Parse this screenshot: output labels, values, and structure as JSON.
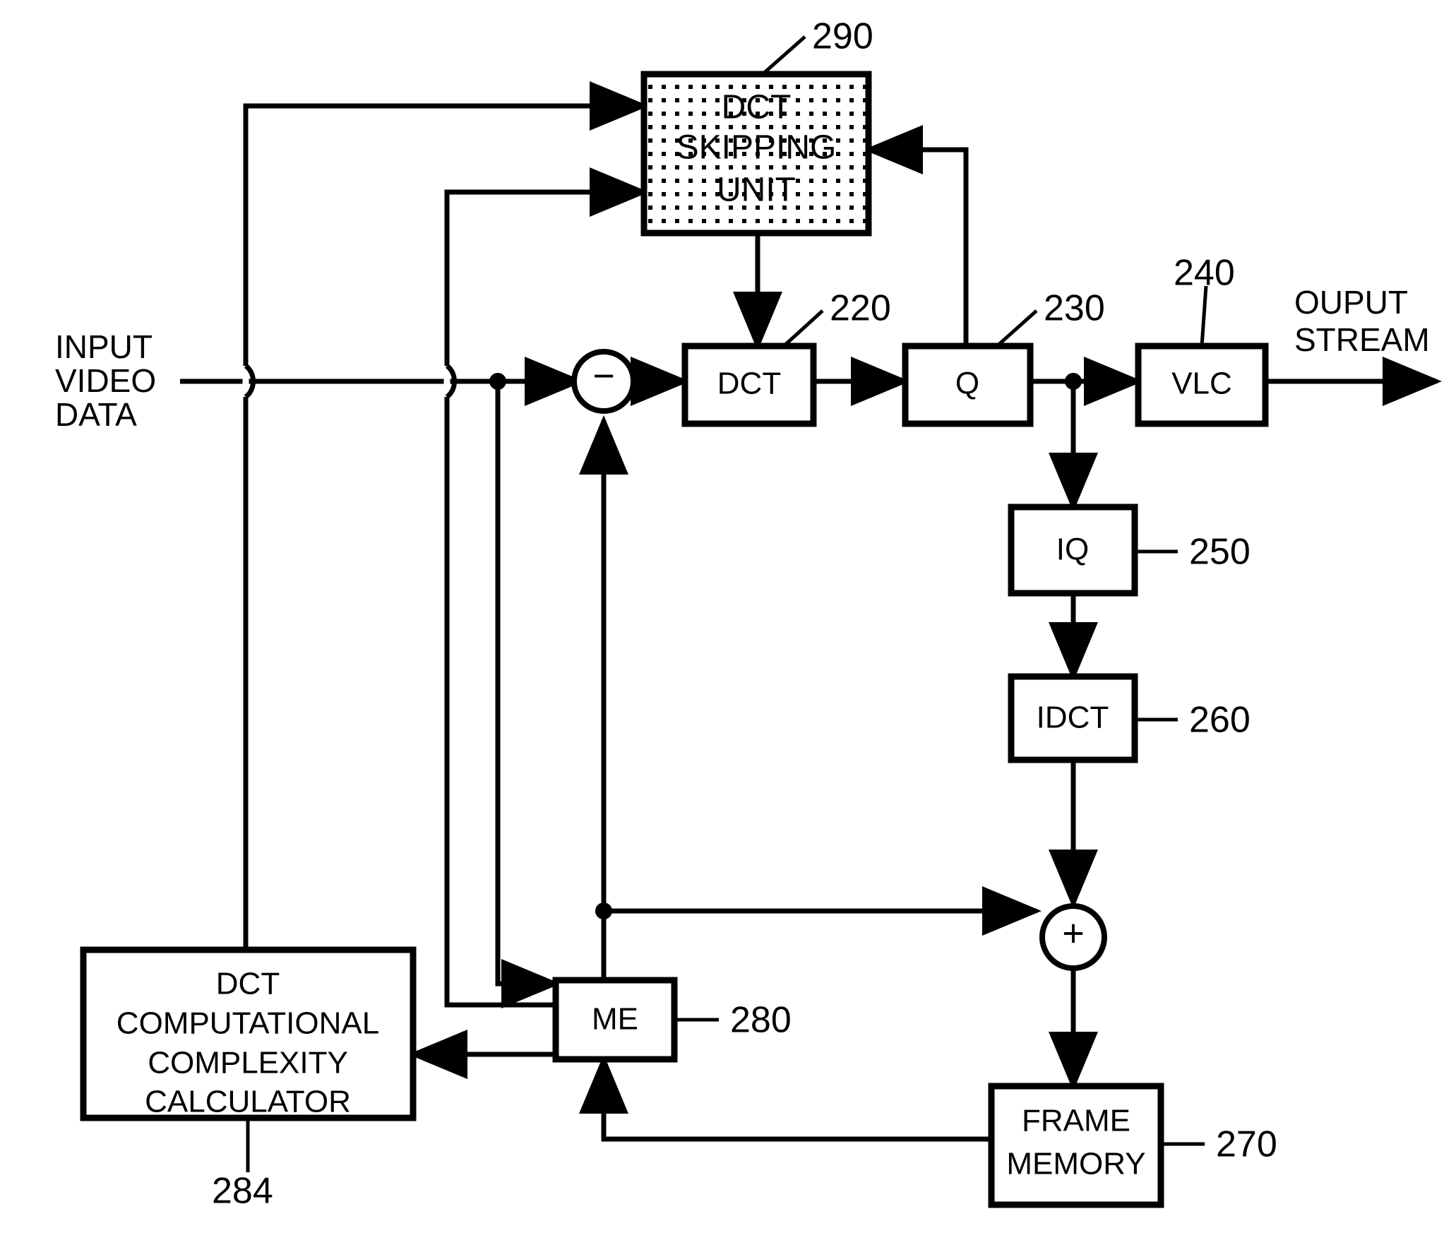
{
  "figure": {
    "type": "patent-block-diagram",
    "title": "Video encoder with DCT skipping unit"
  },
  "blocks": {
    "dct_skipping_unit": {
      "label_lines": [
        "DCT",
        "SKIPPING",
        "UNIT"
      ],
      "ref": "290",
      "fill": "stipple"
    },
    "dct": {
      "label": "DCT",
      "ref": "220"
    },
    "q": {
      "label": "Q",
      "ref": "230"
    },
    "vlc": {
      "label": "VLC",
      "ref": "240"
    },
    "iq": {
      "label": "IQ",
      "ref": "250"
    },
    "idct": {
      "label": "IDCT",
      "ref": "260"
    },
    "frame_memory": {
      "label_lines": [
        "FRAME",
        "MEMORY"
      ],
      "ref": "270"
    },
    "me": {
      "label": "ME",
      "ref": "280"
    },
    "calculator": {
      "label_lines": [
        "DCT",
        "COMPUTATIONAL",
        "COMPLEXITY",
        "CALCULATOR"
      ],
      "ref": "284"
    }
  },
  "operators": {
    "subtractor": {
      "symbol": "−"
    },
    "adder": {
      "symbol": "+"
    }
  },
  "io": {
    "input_label_lines": [
      "INPUT",
      "VIDEO",
      "DATA"
    ],
    "output_label_lines": [
      "OUPUT",
      "STREAM"
    ]
  },
  "colors": {
    "line": "#000000",
    "background": "#ffffff",
    "stipple": "#000000"
  }
}
